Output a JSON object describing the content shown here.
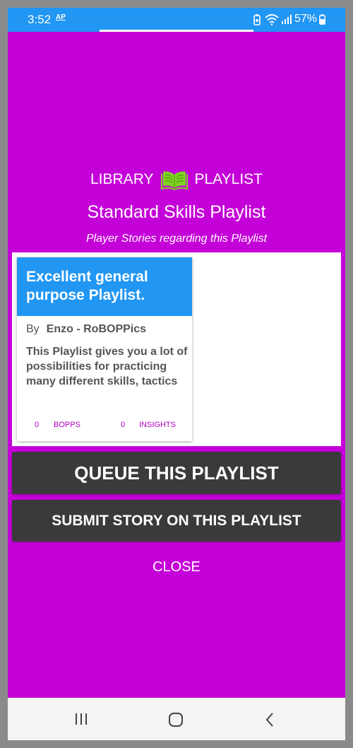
{
  "status_bar": {
    "time": "3:52",
    "ap_label": "AP",
    "battery_percent": "57%",
    "color": "#2196f3"
  },
  "colors": {
    "background": "#c400d8",
    "card_header": "#2196f3",
    "button": "#3a3a3c",
    "book_icon": "#7ed321",
    "card_footer_text": "#b000c0"
  },
  "header": {
    "library_label": "LIBRARY",
    "playlist_label": "PLAYLIST",
    "title": "Standard Skills Playlist",
    "subtitle": "Player Stories regarding this Playlist"
  },
  "story_card": {
    "title": "Excellent general purpose Playlist.",
    "by_label": "By",
    "author": "Enzo - RoBOPPics",
    "body": "This Playlist gives you a lot of possibilities for practicing many different skills, tactics",
    "bopps_count": "0",
    "bopps_label": "BOPPS",
    "insights_count": "0",
    "insights_label": "INSIGHTS"
  },
  "actions": {
    "queue_label": "QUEUE THIS PLAYLIST",
    "submit_label": "SUBMIT STORY ON THIS PLAYLIST",
    "close_label": "CLOSE"
  },
  "icons": {
    "book": "open-book-icon",
    "nav_recents": "recents-icon",
    "nav_home": "home-icon",
    "nav_back": "back-icon"
  }
}
